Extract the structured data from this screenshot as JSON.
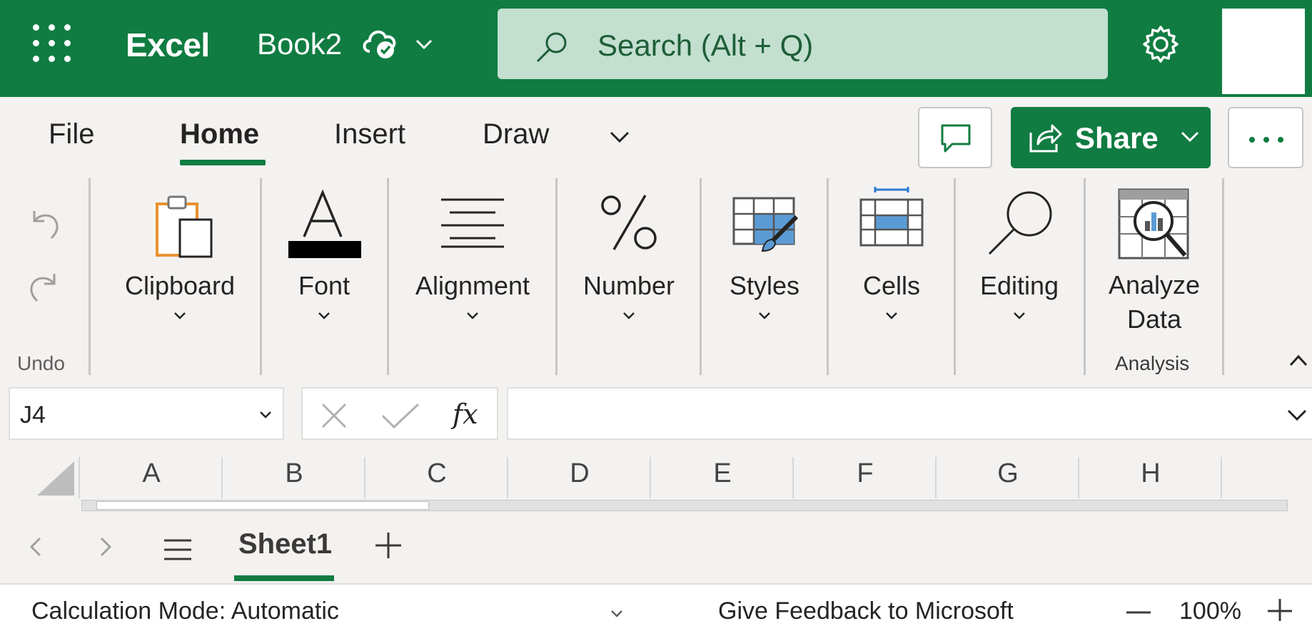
{
  "titlebar": {
    "app_name": "Excel",
    "doc_name": "Book2",
    "search_placeholder": "Search (Alt + Q)",
    "brand_color": "#107c41"
  },
  "tabs": [
    {
      "label": "File",
      "active": false
    },
    {
      "label": "Home",
      "active": true
    },
    {
      "label": "Insert",
      "active": false
    },
    {
      "label": "Draw",
      "active": false
    }
  ],
  "actions": {
    "share_label": "Share"
  },
  "ribbon": {
    "undo_label": "Undo",
    "groups": [
      {
        "label": "Clipboard",
        "icon": "clipboard-icon"
      },
      {
        "label": "Font",
        "icon": "font-icon"
      },
      {
        "label": "Alignment",
        "icon": "alignment-icon"
      },
      {
        "label": "Number",
        "icon": "percent-icon"
      },
      {
        "label": "Styles",
        "icon": "styles-icon"
      },
      {
        "label": "Cells",
        "icon": "cells-icon"
      },
      {
        "label": "Editing",
        "icon": "editing-icon"
      }
    ],
    "analyze": {
      "line1": "Analyze",
      "line2": "Data",
      "group_label": "Analysis"
    }
  },
  "formula_bar": {
    "name_box": "J4",
    "fx_label": "fx",
    "formula_value": ""
  },
  "columns": [
    "A",
    "B",
    "C",
    "D",
    "E",
    "F",
    "G",
    "H"
  ],
  "sheets": [
    {
      "label": "Sheet1",
      "active": true
    }
  ],
  "statusbar": {
    "calc_mode": "Calculation Mode: Automatic",
    "feedback": "Give Feedback to Microsoft",
    "zoom": "100%"
  }
}
